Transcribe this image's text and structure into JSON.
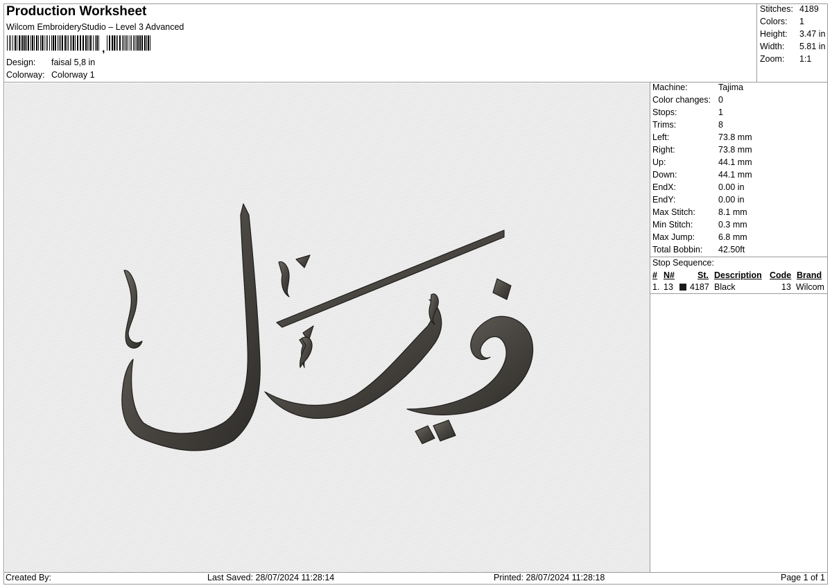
{
  "header": {
    "title": "Production Worksheet",
    "subtitle": "Wilcom EmbroideryStudio – Level 3 Advanced",
    "design_label": "Design:",
    "design_value": "faisal 5,8 in",
    "colorway_label": "Colorway:",
    "colorway_value": "Colorway 1"
  },
  "summary": [
    {
      "label": "Stitches:",
      "value": "4189"
    },
    {
      "label": "Colors:",
      "value": "1"
    },
    {
      "label": "Height:",
      "value": "3.47 in"
    },
    {
      "label": "Width:",
      "value": "5.81 in"
    },
    {
      "label": "Zoom:",
      "value": "1:1"
    }
  ],
  "machine_info": [
    {
      "label": "Machine:",
      "value": "Tajima"
    },
    {
      "label": "Color changes:",
      "value": "0"
    },
    {
      "label": "Stops:",
      "value": "1"
    },
    {
      "label": "Trims:",
      "value": "8"
    },
    {
      "label": "Left:",
      "value": "73.8 mm"
    },
    {
      "label": "Right:",
      "value": "73.8 mm"
    },
    {
      "label": "Up:",
      "value": "44.1 mm"
    },
    {
      "label": "Down:",
      "value": "44.1 mm"
    },
    {
      "label": "EndX:",
      "value": "0.00 in"
    },
    {
      "label": "EndY:",
      "value": "0.00 in"
    },
    {
      "label": "Max Stitch:",
      "value": "8.1 mm"
    },
    {
      "label": "Min Stitch:",
      "value": "0.3 mm"
    },
    {
      "label": "Max Jump:",
      "value": "6.8 mm"
    },
    {
      "label": "Total Bobbin:",
      "value": "42.50ft"
    }
  ],
  "stop_sequence": {
    "title": "Stop Sequence:",
    "columns": [
      "#",
      "N#",
      "St.",
      "Description",
      "Code",
      "Brand"
    ],
    "rows": [
      {
        "index": "1.",
        "n": "13",
        "swatch_color": "#1a1a1a",
        "stitches": "4187",
        "description": "Black",
        "code": "13",
        "brand": "Wilcom"
      }
    ]
  },
  "footer": {
    "created_by": "Created By:",
    "last_saved": "Last Saved: 28/07/2024 11:28:14",
    "printed": "Printed: 28/07/2024 11:28:18",
    "page": "Page 1 of 1"
  },
  "colors": {
    "thread": "#4a4742",
    "canvas_bg": "#ececec",
    "border": "#9a9a9a"
  }
}
